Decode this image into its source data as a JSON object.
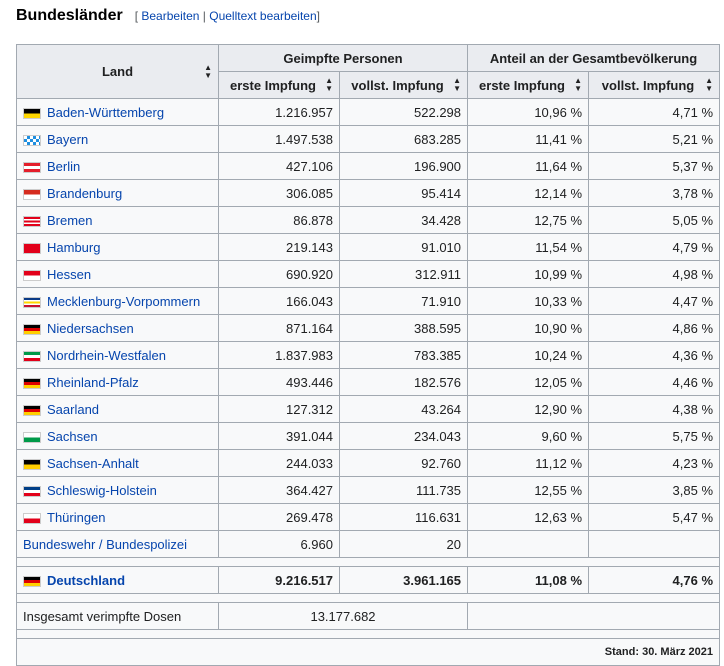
{
  "heading": {
    "title": "Bundesländer",
    "edit_open": "[",
    "edit_link": "Bearbeiten",
    "edit_sep": "|",
    "source_link": "Quelltext bearbeiten",
    "edit_close": "]"
  },
  "table": {
    "header": {
      "land": "Land",
      "group_vaccinated": "Geimpfte Personen",
      "group_share": "Anteil an der Gesamtbevölkerung",
      "first_dose": "erste Impfung",
      "full": "vollst. Impfung",
      "sort_icon": "sort-icon"
    },
    "rows": [
      {
        "name": "Baden-Württemberg",
        "first": "1.216.957",
        "full": "522.298",
        "first_pct": "10,96 %",
        "full_pct": "4,71 %",
        "flag": [
          "#000000",
          "#ffd700"
        ],
        "flag_type": "h2"
      },
      {
        "name": "Bayern",
        "first": "1.497.538",
        "full": "683.285",
        "first_pct": "11,41 %",
        "full_pct": "5,21 %",
        "flag": [
          "#1f8fe0",
          "#ffffff"
        ],
        "flag_type": "check"
      },
      {
        "name": "Berlin",
        "first": "427.106",
        "full": "196.900",
        "first_pct": "11,64 %",
        "full_pct": "5,37 %",
        "flag": [
          "#e41e2b",
          "#ffffff",
          "#e41e2b"
        ],
        "flag_type": "h3"
      },
      {
        "name": "Brandenburg",
        "first": "306.085",
        "full": "95.414",
        "first_pct": "12,14 %",
        "full_pct": "3,78 %",
        "flag": [
          "#d52b1e",
          "#ffffff"
        ],
        "flag_type": "h2"
      },
      {
        "name": "Bremen",
        "first": "86.878",
        "full": "34.428",
        "first_pct": "12,75 %",
        "full_pct": "5,05 %",
        "flag": [
          "#e2001a",
          "#ffffff",
          "#e2001a",
          "#ffffff",
          "#e2001a"
        ],
        "flag_type": "h5"
      },
      {
        "name": "Hamburg",
        "first": "219.143",
        "full": "91.010",
        "first_pct": "11,54 %",
        "full_pct": "4,79 %",
        "flag": [
          "#e2001a"
        ],
        "flag_type": "solid"
      },
      {
        "name": "Hessen",
        "first": "690.920",
        "full": "312.911",
        "first_pct": "10,99 %",
        "full_pct": "4,98 %",
        "flag": [
          "#e2001a",
          "#ffffff"
        ],
        "flag_type": "h2"
      },
      {
        "name": "Mecklenburg-Vorpommern",
        "first": "166.043",
        "full": "71.910",
        "first_pct": "10,33 %",
        "full_pct": "4,47 %",
        "flag": [
          "#0a3a86",
          "#ffffff",
          "#ffd700",
          "#ffffff",
          "#c8102e"
        ],
        "flag_type": "h5"
      },
      {
        "name": "Niedersachsen",
        "first": "871.164",
        "full": "388.595",
        "first_pct": "10,90 %",
        "full_pct": "4,86 %",
        "flag": [
          "#000000",
          "#dd0000",
          "#ffce00"
        ],
        "flag_type": "h3"
      },
      {
        "name": "Nordrhein-Westfalen",
        "first": "1.837.983",
        "full": "783.385",
        "first_pct": "10,24 %",
        "full_pct": "4,36 %",
        "flag": [
          "#009a49",
          "#ffffff",
          "#e2001a"
        ],
        "flag_type": "h3"
      },
      {
        "name": "Rheinland-Pfalz",
        "first": "493.446",
        "full": "182.576",
        "first_pct": "12,05 %",
        "full_pct": "4,46 %",
        "flag": [
          "#000000",
          "#dd0000",
          "#ffce00"
        ],
        "flag_type": "h3"
      },
      {
        "name": "Saarland",
        "first": "127.312",
        "full": "43.264",
        "first_pct": "12,90 %",
        "full_pct": "4,38 %",
        "flag": [
          "#000000",
          "#dd0000",
          "#ffce00"
        ],
        "flag_type": "h3"
      },
      {
        "name": "Sachsen",
        "first": "391.044",
        "full": "234.043",
        "first_pct": "9,60 %",
        "full_pct": "5,75 %",
        "flag": [
          "#ffffff",
          "#009a49"
        ],
        "flag_type": "h2"
      },
      {
        "name": "Sachsen-Anhalt",
        "first": "244.033",
        "full": "92.760",
        "first_pct": "11,12 %",
        "full_pct": "4,23 %",
        "flag": [
          "#000000",
          "#ffce00"
        ],
        "flag_type": "h2"
      },
      {
        "name": "Schleswig-Holstein",
        "first": "364.427",
        "full": "111.735",
        "first_pct": "12,55 %",
        "full_pct": "3,85 %",
        "flag": [
          "#003f87",
          "#ffffff",
          "#e2001a"
        ],
        "flag_type": "h3"
      },
      {
        "name": "Thüringen",
        "first": "269.478",
        "full": "116.631",
        "first_pct": "12,63 %",
        "full_pct": "5,47 %",
        "flag": [
          "#ffffff",
          "#e2001a"
        ],
        "flag_type": "h2"
      }
    ],
    "bundeswehr": {
      "name": "Bundeswehr / Bundespolizei",
      "first": "6.960",
      "full": "20"
    },
    "total": {
      "name": "Deutschland",
      "first": "9.216.517",
      "full": "3.961.165",
      "first_pct": "11,08 %",
      "full_pct": "4,76 %",
      "flag": [
        "#000000",
        "#dd0000",
        "#ffce00"
      ],
      "flag_type": "h3"
    },
    "doses": {
      "label": "Insgesamt verimpfte Dosen",
      "value": "13.177.682"
    },
    "stand": "Stand: 30. März 2021"
  }
}
